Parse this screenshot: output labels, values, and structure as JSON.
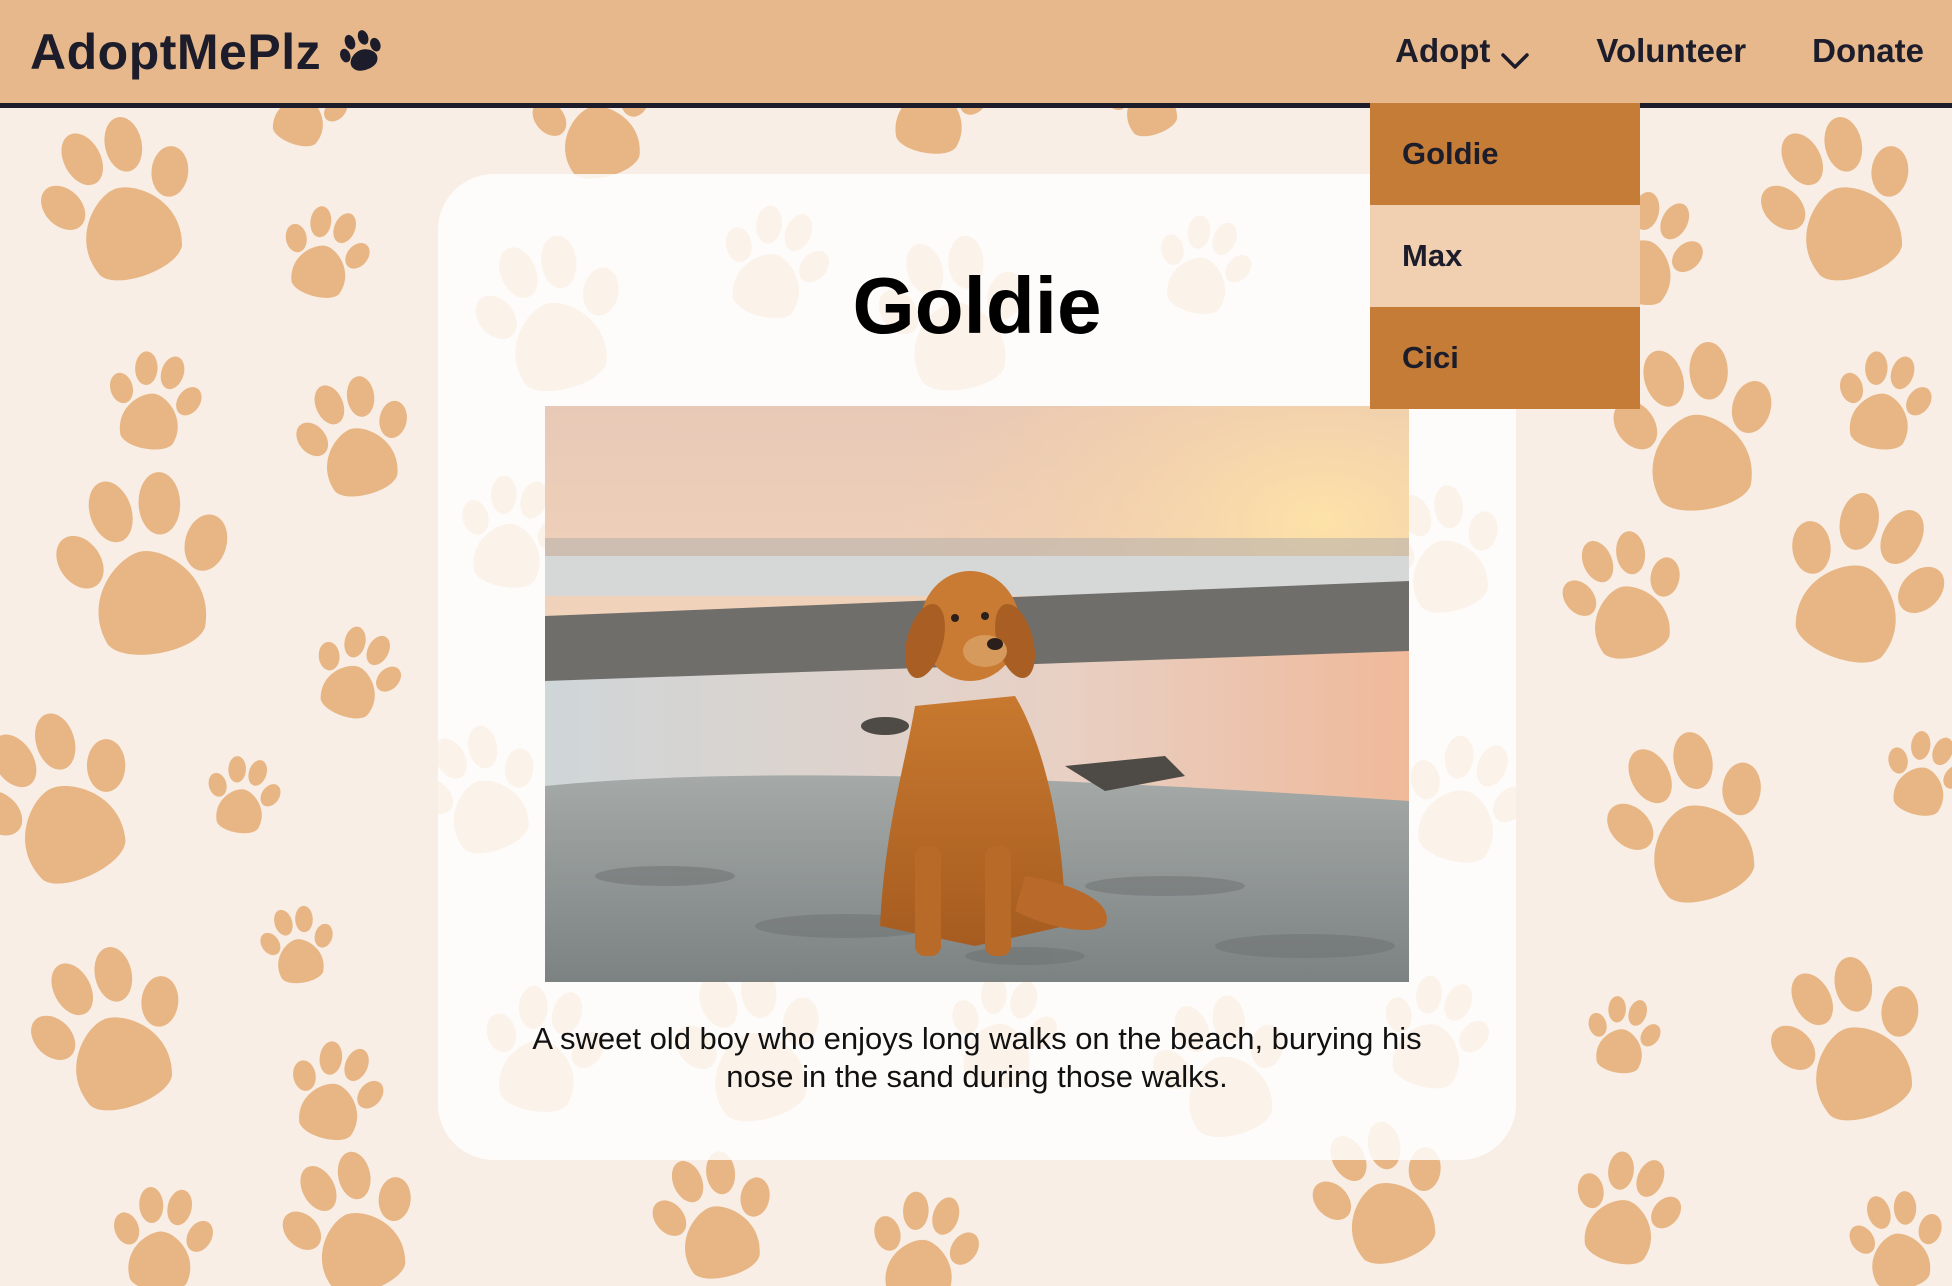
{
  "brand": {
    "name": "AdoptMePlz",
    "icon": "paw-icon"
  },
  "nav": {
    "adopt_label": "Adopt",
    "volunteer_label": "Volunteer",
    "donate_label": "Donate"
  },
  "adopt_menu": {
    "items": [
      {
        "label": "Goldie",
        "state": "active"
      },
      {
        "label": "Max",
        "state": "hover"
      },
      {
        "label": "Cici",
        "state": "normal"
      }
    ]
  },
  "pet": {
    "name": "Goldie",
    "description": "A sweet old boy who enjoys long walks on the beach, burying his nose in the sand during those walks.",
    "photo": "golden-retriever-on-beach"
  },
  "colors": {
    "header_bg": "#e6b88c",
    "header_border": "#1c1c2b",
    "menu_active": "#c47c36",
    "menu_hover": "#f0d0b0",
    "paw": "#e6b07a",
    "page_bg": "#f8ede4"
  }
}
